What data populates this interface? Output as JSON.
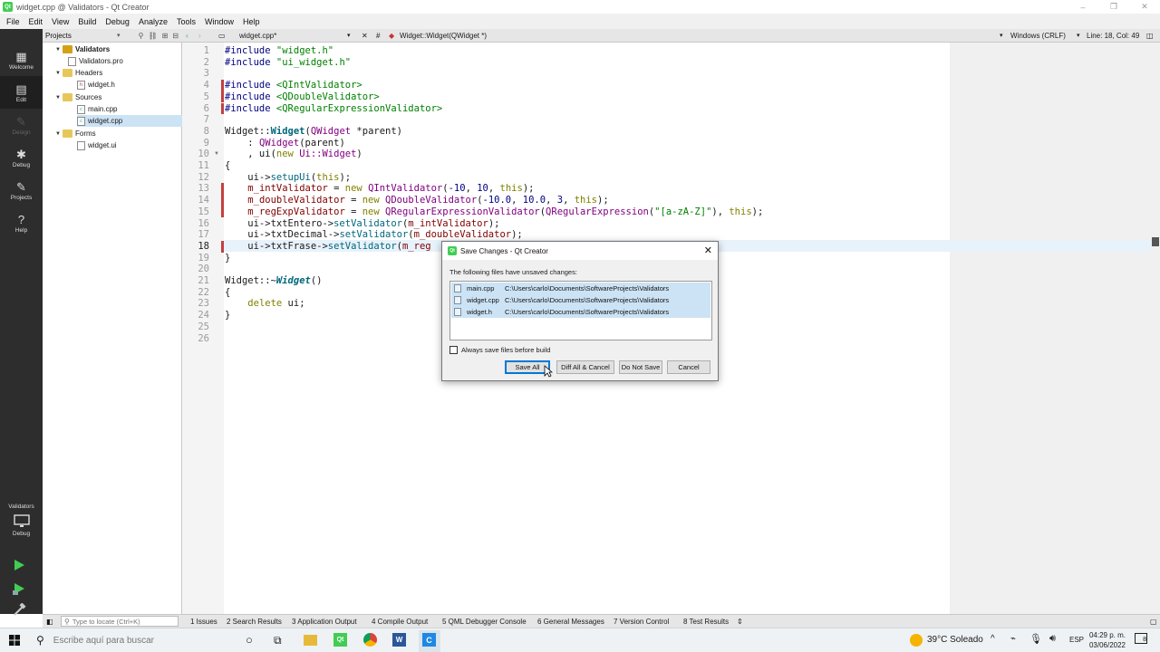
{
  "window": {
    "title": "widget.cpp @ Validators - Qt Creator",
    "app_icon_text": "Qt",
    "controls": [
      "–",
      "❐",
      "✕"
    ]
  },
  "menu": [
    "File",
    "Edit",
    "View",
    "Build",
    "Debug",
    "Analyze",
    "Tools",
    "Window",
    "Help"
  ],
  "modes": [
    {
      "label": "Welcome",
      "icon": "grid-icon",
      "glyph": "▦"
    },
    {
      "label": "Edit",
      "icon": "document-icon",
      "glyph": "▤"
    },
    {
      "label": "Design",
      "icon": "pen-icon",
      "glyph": "✎"
    },
    {
      "label": "Debug",
      "icon": "bug-icon",
      "glyph": "✱"
    },
    {
      "label": "Projects",
      "icon": "wrench-icon",
      "glyph": "✎"
    },
    {
      "label": "Help",
      "icon": "help-icon",
      "glyph": "?"
    }
  ],
  "kit": {
    "project": "Validators",
    "mode": "Debug"
  },
  "sidebar": {
    "header": "Projects",
    "tree": [
      {
        "label": "Validators",
        "type": "project"
      },
      {
        "label": "Validators.pro",
        "type": "file"
      },
      {
        "label": "Headers",
        "type": "folder"
      },
      {
        "label": "widget.h",
        "type": "file"
      },
      {
        "label": "Sources",
        "type": "folder"
      },
      {
        "label": "main.cpp",
        "type": "file"
      },
      {
        "label": "widget.cpp",
        "type": "file"
      },
      {
        "label": "Forms",
        "type": "folder"
      },
      {
        "label": "widget.ui",
        "type": "file"
      }
    ]
  },
  "editor": {
    "open_file": "widget.cpp*",
    "symbol": "Widget::Widget(QWidget *)",
    "line_ending": "Windows (CRLF)",
    "position": "Line: 18, Col: 49",
    "current_line": 18,
    "changed_lines": [
      4,
      5,
      6,
      13,
      14,
      15,
      18
    ],
    "line_numbers": [
      "1",
      "2",
      "3",
      "4",
      "5",
      "6",
      "7",
      "8",
      "9",
      "10",
      "11",
      "12",
      "13",
      "14",
      "15",
      "16",
      "17",
      "18",
      "19",
      "20",
      "21",
      "22",
      "23",
      "24",
      "25",
      "26"
    ],
    "lines": [
      "#include \"widget.h\"",
      "#include \"ui_widget.h\"",
      "",
      "#include <QIntValidator>",
      "#include <QDoubleValidator>",
      "#include <QRegularExpressionValidator>",
      "",
      "Widget::Widget(QWidget *parent)",
      "    : QWidget(parent)",
      "    , ui(new Ui::Widget)",
      "{",
      "    ui->setupUi(this);",
      "    m_intValidator = new QIntValidator(-10, 10, this);",
      "    m_doubleValidator = new QDoubleValidator(-10.0, 10.0, 3, this);",
      "    m_regExpValidator = new QRegularExpressionValidator(QRegularExpression(\"[a-zA-Z]\"), this);",
      "    ui->txtEntero->setValidator(m_intValidator);",
      "    ui->txtDecimal->setValidator(m_doubleValidator);",
      "    ui->txtFrase->setValidator(m_reg",
      "}",
      "",
      "Widget::~Widget()",
      "{",
      "    delete ui;",
      "}",
      "",
      ""
    ]
  },
  "dialog": {
    "title": "Save Changes - Qt Creator",
    "message": "The following files have unsaved changes:",
    "files": [
      {
        "name": "main.cpp",
        "path": "C:\\Users\\carlo\\Documents\\SoftwareProjects\\Validators"
      },
      {
        "name": "widget.cpp",
        "path": "C:\\Users\\carlo\\Documents\\SoftwareProjects\\Validators"
      },
      {
        "name": "widget.h",
        "path": "C:\\Users\\carlo\\Documents\\SoftwareProjects\\Validators"
      }
    ],
    "checkbox_label": "Always save files before build",
    "checkbox_checked": false,
    "buttons": [
      "Save All",
      "Diff All & Cancel",
      "Do Not Save",
      "Cancel"
    ]
  },
  "statusbar": {
    "locator_placeholder": "Type to locate (Ctrl+K)",
    "panes": [
      "1  Issues",
      "2  Search Results",
      "3  Application Output",
      "4  Compile Output",
      "5  QML Debugger Console",
      "6  General Messages",
      "7  Version Control",
      "8  Test Results"
    ]
  },
  "taskbar": {
    "search_placeholder": "Escribe aquí para buscar",
    "weather": "39°C  Soleado",
    "language": "ESP",
    "time": "04:29 p. m.",
    "date": "03/06/2022",
    "notification_count": "8"
  },
  "colors": {
    "accent": "#0078d7",
    "qt_green": "#41cd52",
    "modebar": "#2d2d2d",
    "selection": "#cce3f5",
    "change_marker": "#c24040"
  }
}
